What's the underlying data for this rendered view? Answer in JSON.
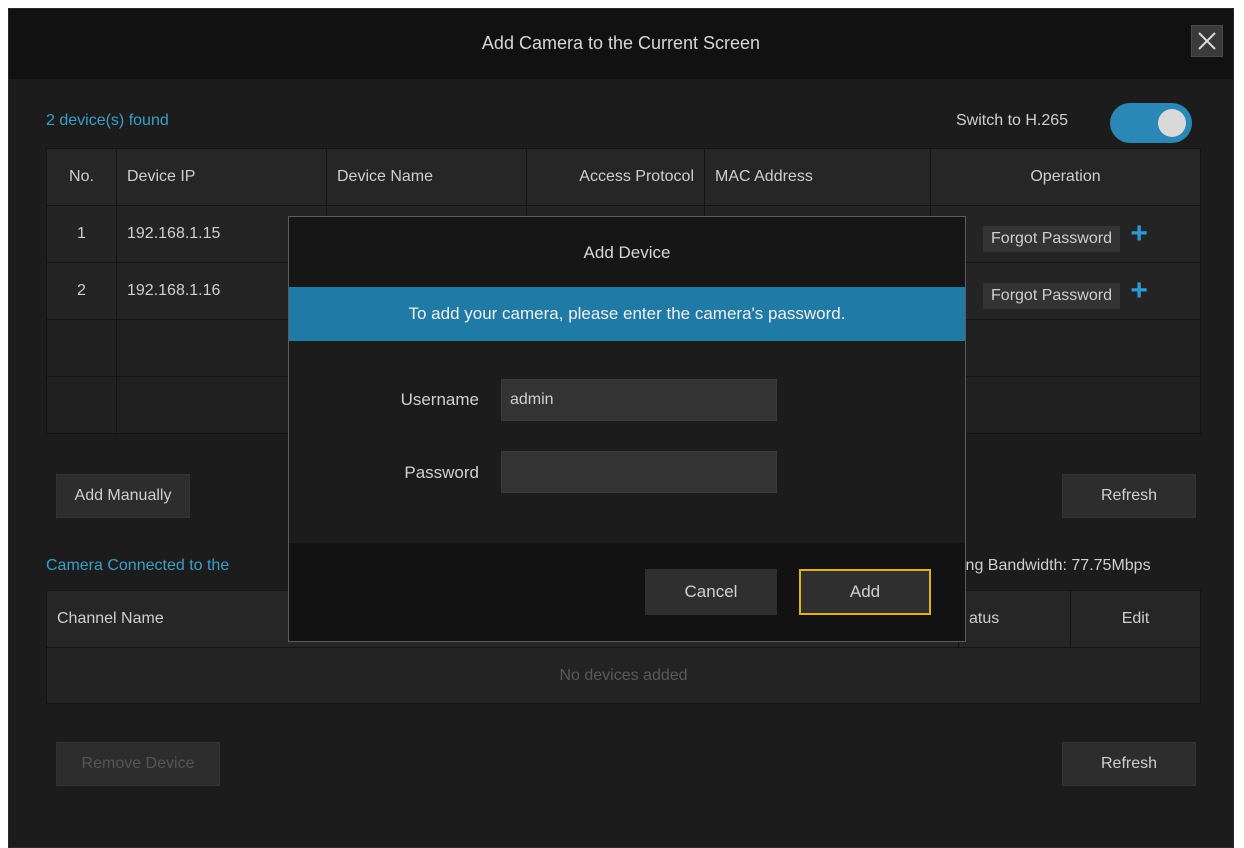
{
  "window": {
    "title": "Add Camera to the Current Screen"
  },
  "discovery": {
    "found_text": "2 device(s) found",
    "switch_label": "Switch to H.265",
    "switch_on": true,
    "columns": [
      "No.",
      "Device IP",
      "Device Name",
      "Access Protocol",
      "MAC Address",
      "Operation"
    ],
    "rows": [
      {
        "no": "1",
        "ip": "192.168.1.15",
        "forgot": "Forgot Password"
      },
      {
        "no": "2",
        "ip": "192.168.1.16",
        "forgot": "Forgot Password"
      }
    ],
    "add_manually": "Add Manually",
    "refresh": "Refresh"
  },
  "connected": {
    "label": "Camera Connected to the",
    "bandwidth": "ing Bandwidth: 77.75Mbps",
    "columns": [
      "Channel Name",
      "atus",
      "Edit"
    ],
    "empty_text": "No devices added",
    "remove": "Remove Device",
    "refresh": "Refresh"
  },
  "dialog": {
    "title": "Add Device",
    "banner": "To add your camera, please enter the camera's password.",
    "username_label": "Username",
    "username_value": "admin",
    "password_label": "Password",
    "password_value": "",
    "cancel": "Cancel",
    "add": "Add"
  },
  "colors": {
    "accent": "#1f7aa5",
    "link": "#3a9ec9",
    "focus": "#e0b020",
    "background": "#1c1c1c"
  }
}
